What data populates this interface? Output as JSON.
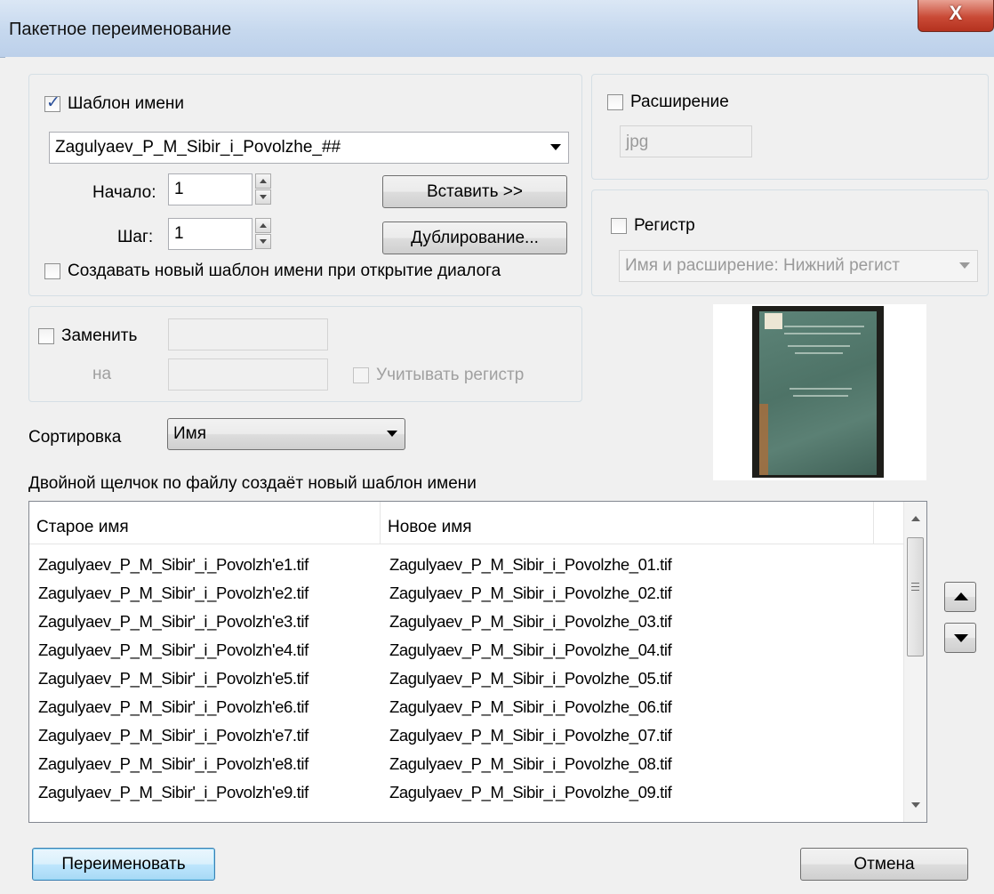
{
  "window": {
    "title": "Пакетное переименование",
    "close_label": "X"
  },
  "template": {
    "checkbox_label": "Шаблон имени",
    "checked": true,
    "value": "Zagulyaev_P_M_Sibir_i_Povolzhe_##",
    "start_label": "Начало:",
    "start_value": "1",
    "step_label": "Шаг:",
    "step_value": "1",
    "insert_button": "Вставить >>",
    "duplicate_button": "Дублирование...",
    "new_template_label": "Создавать новый шаблон имени при открытие диалога"
  },
  "extension": {
    "checkbox_label": "Расширение",
    "value": "jpg"
  },
  "case": {
    "checkbox_label": "Регистр",
    "value": "Имя и расширение: Нижний регист"
  },
  "replace": {
    "checkbox_label": "Заменить",
    "with_label": "на",
    "match_case_label": "Учитывать регистр"
  },
  "sort": {
    "label": "Сортировка",
    "value": "Имя"
  },
  "hint": "Двойной щелчок по файлу создаёт новый шаблон имени",
  "files": {
    "columns": [
      "Старое имя",
      "Новое имя"
    ],
    "rows": [
      [
        "Zagulyaev_P_M_Sibir'_i_Povolzh'e1.tif",
        "Zagulyaev_P_M_Sibir_i_Povolzhe_01.tif"
      ],
      [
        "Zagulyaev_P_M_Sibir'_i_Povolzh'e2.tif",
        "Zagulyaev_P_M_Sibir_i_Povolzhe_02.tif"
      ],
      [
        "Zagulyaev_P_M_Sibir'_i_Povolzh'e3.tif",
        "Zagulyaev_P_M_Sibir_i_Povolzhe_03.tif"
      ],
      [
        "Zagulyaev_P_M_Sibir'_i_Povolzh'e4.tif",
        "Zagulyaev_P_M_Sibir_i_Povolzhe_04.tif"
      ],
      [
        "Zagulyaev_P_M_Sibir'_i_Povolzh'e5.tif",
        "Zagulyaev_P_M_Sibir_i_Povolzhe_05.tif"
      ],
      [
        "Zagulyaev_P_M_Sibir'_i_Povolzh'e6.tif",
        "Zagulyaev_P_M_Sibir_i_Povolzhe_06.tif"
      ],
      [
        "Zagulyaev_P_M_Sibir'_i_Povolzh'e7.tif",
        "Zagulyaev_P_M_Sibir_i_Povolzhe_07.tif"
      ],
      [
        "Zagulyaev_P_M_Sibir'_i_Povolzh'e8.tif",
        "Zagulyaev_P_M_Sibir_i_Povolzhe_08.tif"
      ],
      [
        "Zagulyaev_P_M_Sibir'_i_Povolzh'e9.tif",
        "Zagulyaev_P_M_Sibir_i_Povolzhe_09.tif"
      ]
    ]
  },
  "actions": {
    "rename_button": "Переименовать",
    "cancel_button": "Отмена"
  },
  "icons": {
    "close": "close-icon",
    "move_up": "arrow-up-icon",
    "move_down": "arrow-down-icon",
    "dropdown": "chevron-down-icon"
  }
}
